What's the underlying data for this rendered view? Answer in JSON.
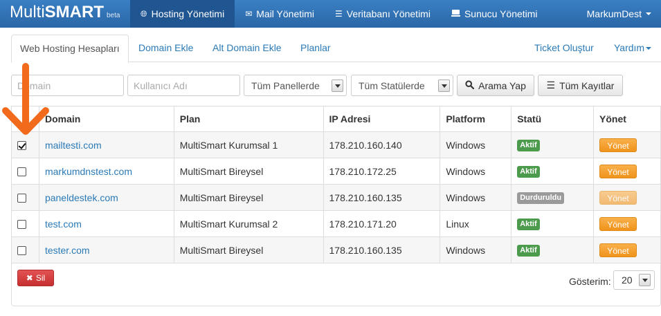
{
  "brand": {
    "name_light": "Multi",
    "name_bold": "SMART",
    "tag": "beta"
  },
  "nav": {
    "items": [
      {
        "label": "Hosting Yönetimi",
        "icon": "globe-icon"
      },
      {
        "label": "Mail Yönetimi",
        "icon": "envelope-icon"
      },
      {
        "label": "Veritabanı Yönetimi",
        "icon": "list-icon"
      },
      {
        "label": "Sunucu Yönetimi",
        "icon": "server-icon"
      }
    ],
    "user": "MarkumDest"
  },
  "tabs": {
    "items": [
      "Web Hosting Hesapları",
      "Domain Ekle",
      "Alt Domain Ekle",
      "Planlar"
    ],
    "ticket": "Ticket Oluştur",
    "help": "Yardım"
  },
  "filters": {
    "domain_placeholder": "Domain",
    "username_placeholder": "Kullanıcı Adı",
    "panel_select": "Tüm Panellerde",
    "status_select": "Tüm Statülerde",
    "search_button": "Arama Yap",
    "all_records_button": "Tüm Kayıtlar"
  },
  "table": {
    "headers": [
      "Domain",
      "Plan",
      "IP Adresi",
      "Platform",
      "Statü",
      "Yönet"
    ],
    "rows": [
      {
        "checked": true,
        "domain": "mailtesti.com",
        "plan": "MultiSmart Kurumsal 1",
        "ip": "178.210.160.140",
        "platform": "Windows",
        "status": "Aktif",
        "action": "Yönet"
      },
      {
        "checked": false,
        "domain": "markumdnstest.com",
        "plan": "MultiSmart Bireysel",
        "ip": "178.210.172.25",
        "platform": "Windows",
        "status": "Aktif",
        "action": "Yönet"
      },
      {
        "checked": false,
        "domain": "paneldestek.com",
        "plan": "MultiSmart Bireysel",
        "ip": "178.210.160.135",
        "platform": "Windows",
        "status": "Durduruldu",
        "action": "Yönet"
      },
      {
        "checked": false,
        "domain": "test.com",
        "plan": "MultiSmart Kurumsal 2",
        "ip": "178.210.171.20",
        "platform": "Linux",
        "status": "Aktif",
        "action": "Yönet"
      },
      {
        "checked": false,
        "domain": "tester.com",
        "plan": "MultiSmart Bireysel",
        "ip": "178.210.160.135",
        "platform": "Windows",
        "status": "Aktif",
        "action": "Yönet"
      }
    ]
  },
  "footer": {
    "delete_button": "Sil",
    "show_label": "Gösterim:",
    "page_size": "20"
  },
  "colors": {
    "navbar": "#2a66a6",
    "link": "#2a7ab8",
    "status_active": "#4c9a4c",
    "status_stopped": "#9a9a9a",
    "manage_button": "#f0931c",
    "delete_button": "#c62f2f",
    "annotation_arrow": "#f26a1b"
  }
}
